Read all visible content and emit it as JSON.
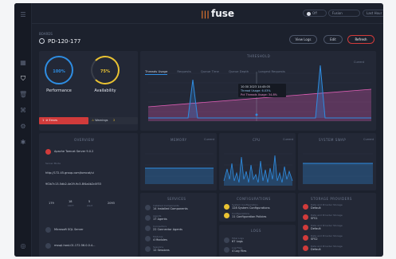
{
  "brand": {
    "name": "fuse"
  },
  "topbar": {
    "toggle_label": "Off",
    "select_1": "Fusion",
    "select_2": "Last Hour"
  },
  "breadcrumb": "BOARDS",
  "page_title": "PD-120-177",
  "actions": {
    "view_logs": "View Logs",
    "edit": "Edit",
    "refresh": "Refresh"
  },
  "status": {
    "performance": {
      "value": "100%",
      "label": "Performance"
    },
    "availability": {
      "value": "75%",
      "label": "Availability"
    },
    "errors_label": "Errors",
    "errors_count": "1",
    "warnings_label": "Warnings",
    "warnings_count": "2"
  },
  "threshold": {
    "title": "THRESHOLD",
    "tabs": [
      "Threads Usage",
      "Requests",
      "Queue Time",
      "Queue Depth",
      "Longest Requests"
    ],
    "current_label": "Current",
    "tooltip": {
      "time": "10:30 2023 14:45:05",
      "line1": "Thread Usage: 6.03%",
      "line2": "Pct Threads Usage: 34.8%"
    }
  },
  "overview": {
    "title": "OVERVIEW",
    "server_name": "Apache Tomcat Server 9.0.2",
    "server_mode_label": "Server Mode",
    "url": "http://172.45.group.com/tomcat/ui",
    "id": "9f2b7c13-5db2-4e29-9c3-8f4a4b2c0f33",
    "stats": [
      {
        "value": "179",
        "label": ""
      },
      {
        "value": "18",
        "label": "1977"
      },
      {
        "value": "5",
        "label": "Alert"
      },
      {
        "value": "2093",
        "label": ""
      }
    ],
    "item_1": "Microsoft SQL Server",
    "item_2": "mssql-host-01.172.56.0.0.4..."
  },
  "memory": {
    "title": "MEMORY",
    "current_label": "Current"
  },
  "cpu": {
    "title": "CPU",
    "current_label": "Current"
  },
  "system_swap": {
    "title": "SYSTEM SWAP",
    "current_label": "Current"
  },
  "services": {
    "title": "SERVICES",
    "items": [
      {
        "name": "Installed Components",
        "value": "14 Installed Components"
      },
      {
        "name": "Agents",
        "value": "17 Agents"
      },
      {
        "name": "Connectors",
        "value": "22 Connector Agents"
      },
      {
        "name": "Modules",
        "value": "4 Modules"
      },
      {
        "name": "Sessions",
        "value": "12 Sessions"
      }
    ]
  },
  "configurations": {
    "title": "CONFIGURATIONS",
    "items": [
      {
        "name": "System Configuration",
        "value": "128 System Configurations"
      },
      {
        "name": "Configurations",
        "value": "11 Configuration Policies"
      }
    ]
  },
  "logs": {
    "title": "LOGS",
    "items": [
      {
        "name": "Total Logs",
        "value": "67 Logs"
      },
      {
        "name": "Log Files",
        "value": "4 Log Files"
      }
    ]
  },
  "storage": {
    "title": "STORAGE PROVIDERS",
    "items": [
      {
        "name": "Data and Provider Storage",
        "value": "Default"
      },
      {
        "name": "Data and Provider Storage",
        "value": "SFS1"
      },
      {
        "name": "Data and Provider Storage",
        "value": "Default"
      },
      {
        "name": "Data and Provider Storage",
        "value": "SFS2"
      },
      {
        "name": "Data and Provider Storage",
        "value": "Default"
      }
    ]
  },
  "colors": {
    "accent": "#2e8de2",
    "danger": "#d13b3b",
    "warning": "#e9c232",
    "brand": "#e8792f",
    "area_pink": "#c44fa0"
  }
}
